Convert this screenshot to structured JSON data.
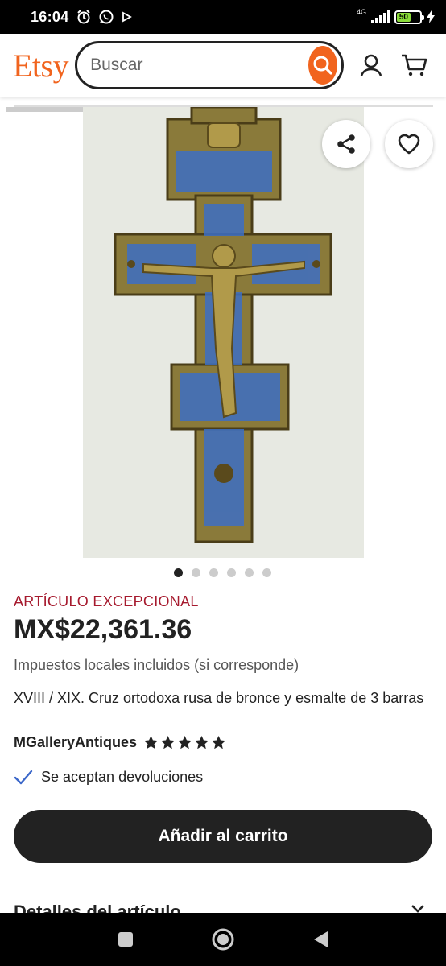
{
  "status_bar": {
    "time": "16:04",
    "network": "4G",
    "battery": "50"
  },
  "header": {
    "logo": "Etsy",
    "search_placeholder": "Buscar"
  },
  "icons": {
    "search": "search-icon",
    "account": "user-icon",
    "cart": "cart-icon",
    "share": "share-icon",
    "favorite": "heart-icon",
    "check": "check-icon",
    "chevron": "chevron-down-icon",
    "star": "star-icon"
  },
  "gallery": {
    "image_count": 6,
    "active_index": 0
  },
  "listing": {
    "badge": "ARTÍCULO EXCEPCIONAL",
    "price": "MX$22,361.36",
    "tax_note": "Impuestos locales incluidos (si corresponde)",
    "title": "XVIII / XIX. Cruz ortodoxa rusa de bronce y esmalte de 3 barras",
    "shop_name": "MGalleryAntiques",
    "rating": 5,
    "returns": "Se aceptan devoluciones",
    "add_to_cart": "Añadir al carrito",
    "details_label": "Detalles del artículo"
  },
  "colors": {
    "brand": "#f1641e",
    "badge": "#a61a2e",
    "button": "#222222"
  }
}
